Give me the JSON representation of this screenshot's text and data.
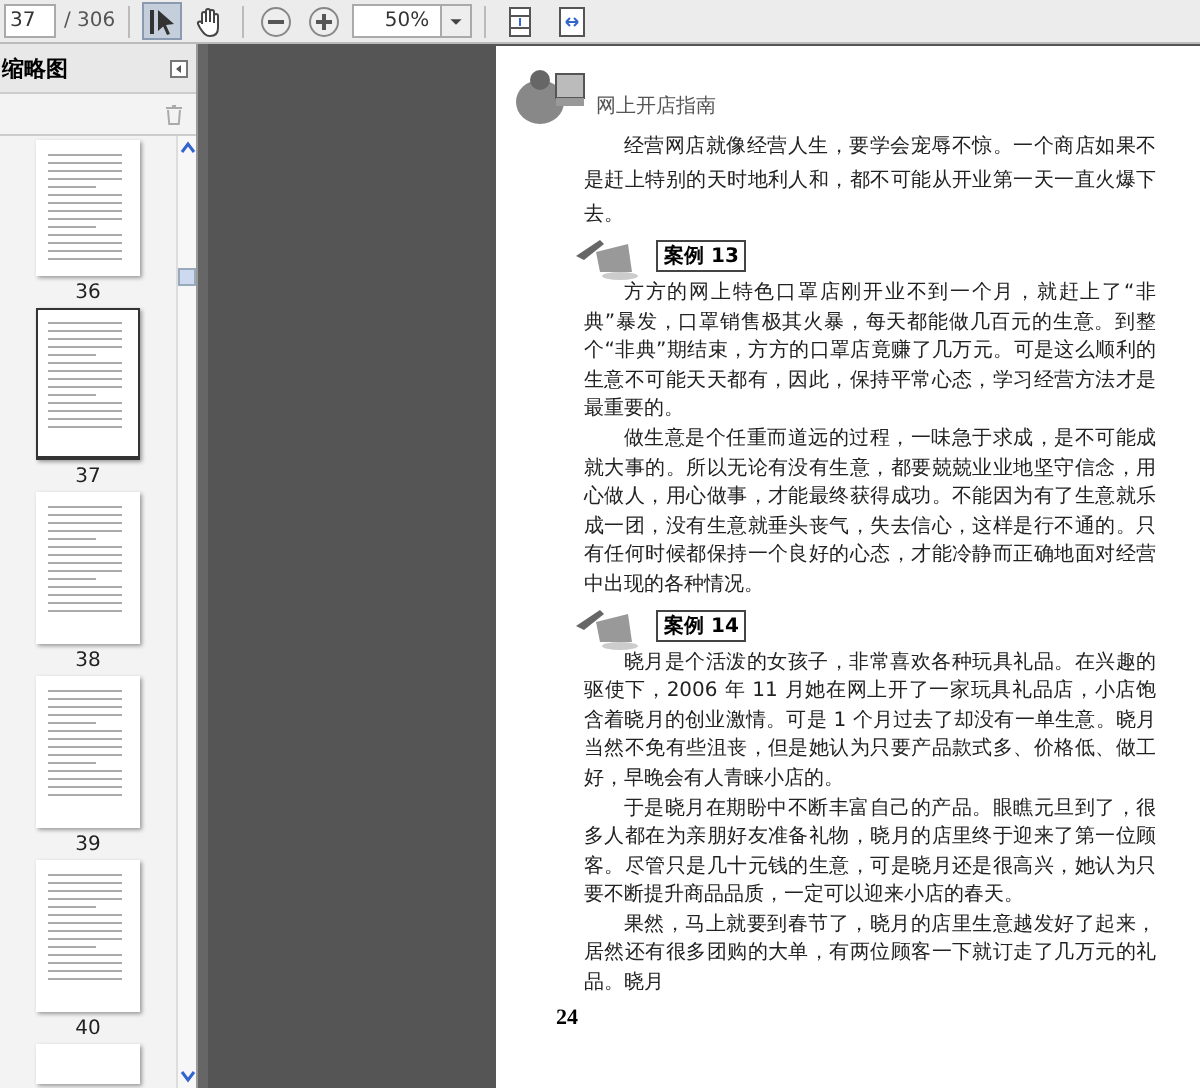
{
  "toolbar": {
    "page_field": "37",
    "page_total": "/ 306",
    "tools": [
      {
        "kind": "select",
        "selected": true
      },
      {
        "kind": "hand",
        "selected": false
      }
    ],
    "zoom_field": "50%"
  },
  "sidebar": {
    "title": "缩略图",
    "thumbnails": [
      {
        "label": "36",
        "selected": false
      },
      {
        "label": "37",
        "selected": true
      },
      {
        "label": "38",
        "selected": false
      },
      {
        "label": "39",
        "selected": false
      },
      {
        "label": "40",
        "selected": false
      }
    ]
  },
  "page": {
    "header": "网上开店指南",
    "blocks": [
      {
        "kind": "para",
        "text": "经营网店就像经营人生，要学会宠辱不惊。一个商店如果不是赶上特别的天时地利人和，都不可能从开业第一天一直火爆下去。"
      },
      {
        "kind": "case",
        "text": "案例 13"
      },
      {
        "kind": "para",
        "text": "方方的网上特色口罩店刚开业不到一个月，就赶上了“非典”暴发，口罩销售极其火暴，每天都能做几百元的生意。到整个“非典”期结束，方方的口罩店竟赚了几万元。可是这么顺利的生意不可能天天都有，因此，保持平常心态，学习经营方法才是最重要的。"
      },
      {
        "kind": "para",
        "text": "做生意是个任重而道远的过程，一味急于求成，是不可能成就大事的。所以无论有没有生意，都要兢兢业业地坚守信念，用心做人，用心做事，才能最终获得成功。不能因为有了生意就乐成一团，没有生意就垂头丧气，失去信心，这样是行不通的。只有任何时候都保持一个良好的心态，才能冷静而正确地面对经营中出现的各种情况。"
      },
      {
        "kind": "case",
        "text": "案例 14"
      },
      {
        "kind": "para",
        "text": "晓月是个活泼的女孩子，非常喜欢各种玩具礼品。在兴趣的驱使下，2006 年 11 月她在网上开了一家玩具礼品店，小店饱含着晓月的创业激情。可是 1 个月过去了却没有一单生意。晓月当然不免有些沮丧，但是她认为只要产品款式多、价格低、做工好，早晚会有人青睐小店的。"
      },
      {
        "kind": "para",
        "text": "于是晓月在期盼中不断丰富自己的产品。眼瞧元旦到了，很多人都在为亲朋好友准备礼物，晓月的店里终于迎来了第一位顾客。尽管只是几十元钱的生意，可是晓月还是很高兴，她认为只要不断提升商品品质，一定可以迎来小店的春天。"
      },
      {
        "kind": "para",
        "text": "果然，马上就要到春节了，晓月的店里生意越发好了起来，居然还有很多团购的大单，有两位顾客一下就订走了几万元的礼品。晓月"
      }
    ],
    "page_number": "24"
  }
}
